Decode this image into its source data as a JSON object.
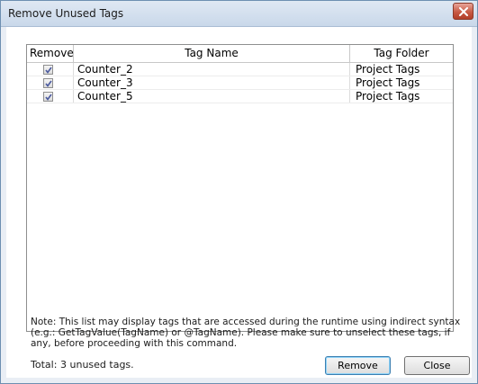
{
  "window": {
    "title": "Remove Unused Tags"
  },
  "columns": {
    "remove": "Remove",
    "tag_name": "Tag Name",
    "tag_folder": "Tag Folder"
  },
  "rows": [
    {
      "checked": true,
      "tag_name": "Counter_2",
      "tag_folder": "Project Tags"
    },
    {
      "checked": true,
      "tag_name": "Counter_3",
      "tag_folder": "Project Tags"
    },
    {
      "checked": true,
      "tag_name": "Counter_5",
      "tag_folder": "Project Tags"
    }
  ],
  "note": "Note: This list may display tags that are accessed during the runtime using indirect syntax (e.g.: GetTagValue(TagName) or @TagName). Please make sure to unselect these tags, if any, before proceeding with this command.",
  "total": {
    "label": "Total:",
    "count_text": "3 unused tags."
  },
  "buttons": {
    "remove": "Remove",
    "close": "Close"
  },
  "colors": {
    "title_bar": "#c9d8ea",
    "close_button": "#c85a44",
    "default_button_border": "#3c7fb1"
  }
}
